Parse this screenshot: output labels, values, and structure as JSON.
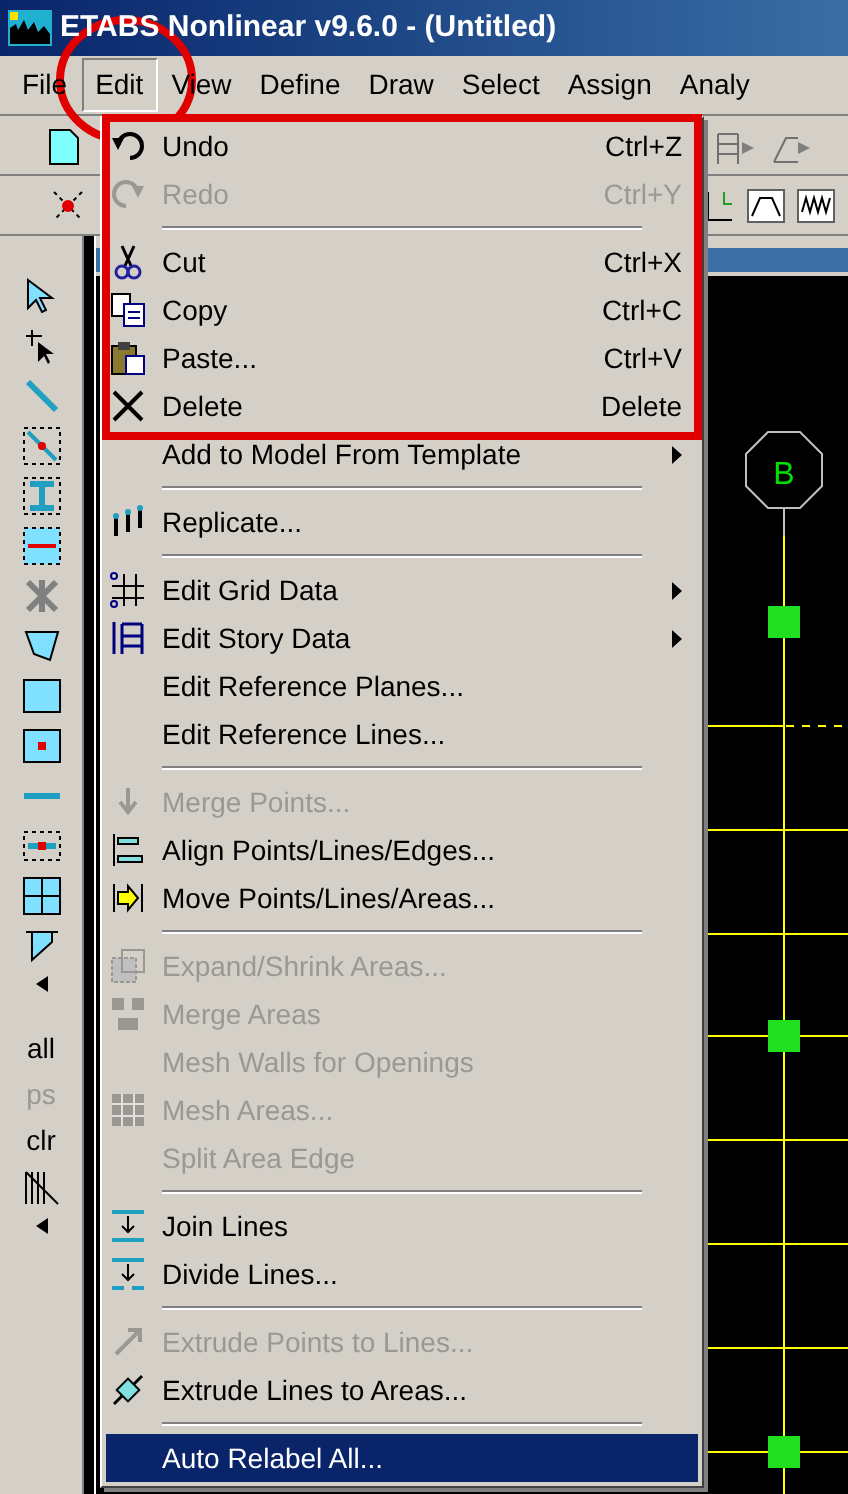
{
  "window": {
    "title": "ETABS Nonlinear v9.6.0 - (Untitled)"
  },
  "menu_bar": [
    {
      "label": "File",
      "selected": false
    },
    {
      "label": "Edit",
      "selected": true
    },
    {
      "label": "View",
      "selected": false
    },
    {
      "label": "Define",
      "selected": false
    },
    {
      "label": "Draw",
      "selected": false
    },
    {
      "label": "Select",
      "selected": false
    },
    {
      "label": "Assign",
      "selected": false
    },
    {
      "label": "Analy",
      "selected": false
    }
  ],
  "edit_menu": [
    {
      "kind": "item",
      "label": "Undo",
      "shortcut": "Ctrl+Z",
      "disabled": false,
      "submenu": false,
      "selected": false
    },
    {
      "kind": "item",
      "label": "Redo",
      "shortcut": "Ctrl+Y",
      "disabled": true,
      "submenu": false,
      "selected": false
    },
    {
      "kind": "separator"
    },
    {
      "kind": "item",
      "label": "Cut",
      "shortcut": "Ctrl+X",
      "disabled": false,
      "submenu": false,
      "selected": false
    },
    {
      "kind": "item",
      "label": "Copy",
      "shortcut": "Ctrl+C",
      "disabled": false,
      "submenu": false,
      "selected": false
    },
    {
      "kind": "item",
      "label": "Paste...",
      "shortcut": "Ctrl+V",
      "disabled": false,
      "submenu": false,
      "selected": false
    },
    {
      "kind": "item",
      "label": "Delete",
      "shortcut": "Delete",
      "disabled": false,
      "submenu": false,
      "selected": false
    },
    {
      "kind": "item",
      "label": "Add to Model From Template",
      "disabled": false,
      "submenu": true,
      "selected": false
    },
    {
      "kind": "separator"
    },
    {
      "kind": "item",
      "label": "Replicate...",
      "disabled": false,
      "submenu": false,
      "selected": false
    },
    {
      "kind": "separator"
    },
    {
      "kind": "item",
      "label": "Edit Grid Data",
      "disabled": false,
      "submenu": true,
      "selected": false
    },
    {
      "kind": "item",
      "label": "Edit Story Data",
      "disabled": false,
      "submenu": true,
      "selected": false
    },
    {
      "kind": "item",
      "label": "Edit Reference Planes...",
      "disabled": false,
      "submenu": false,
      "selected": false
    },
    {
      "kind": "item",
      "label": "Edit Reference Lines...",
      "disabled": false,
      "submenu": false,
      "selected": false
    },
    {
      "kind": "separator"
    },
    {
      "kind": "item",
      "label": "Merge Points...",
      "disabled": true,
      "submenu": false,
      "selected": false
    },
    {
      "kind": "item",
      "label": "Align Points/Lines/Edges...",
      "disabled": false,
      "submenu": false,
      "selected": false
    },
    {
      "kind": "item",
      "label": "Move Points/Lines/Areas...",
      "disabled": false,
      "submenu": false,
      "selected": false
    },
    {
      "kind": "separator"
    },
    {
      "kind": "item",
      "label": "Expand/Shrink Areas...",
      "disabled": true,
      "submenu": false,
      "selected": false
    },
    {
      "kind": "item",
      "label": "Merge Areas",
      "disabled": true,
      "submenu": false,
      "selected": false
    },
    {
      "kind": "item",
      "label": "Mesh Walls for Openings",
      "disabled": true,
      "submenu": false,
      "selected": false
    },
    {
      "kind": "item",
      "label": "Mesh Areas...",
      "disabled": true,
      "submenu": false,
      "selected": false
    },
    {
      "kind": "item",
      "label": "Split Area Edge",
      "disabled": true,
      "submenu": false,
      "selected": false
    },
    {
      "kind": "separator"
    },
    {
      "kind": "item",
      "label": "Join Lines",
      "disabled": false,
      "submenu": false,
      "selected": false
    },
    {
      "kind": "item",
      "label": "Divide Lines...",
      "disabled": false,
      "submenu": false,
      "selected": false
    },
    {
      "kind": "separator"
    },
    {
      "kind": "item",
      "label": "Extrude Points to Lines...",
      "disabled": true,
      "submenu": false,
      "selected": false
    },
    {
      "kind": "item",
      "label": "Extrude Lines to Areas...",
      "disabled": false,
      "submenu": false,
      "selected": false
    },
    {
      "kind": "separator"
    },
    {
      "kind": "item",
      "label": "Auto Relabel All...",
      "disabled": false,
      "submenu": false,
      "selected": true
    }
  ],
  "left_toolbar": {
    "select_buttons": [
      {
        "label": "all",
        "disabled": false
      },
      {
        "label": "ps",
        "disabled": true
      },
      {
        "label": "clr",
        "disabled": false
      }
    ]
  },
  "canvas": {
    "grid_bubble": "B"
  }
}
